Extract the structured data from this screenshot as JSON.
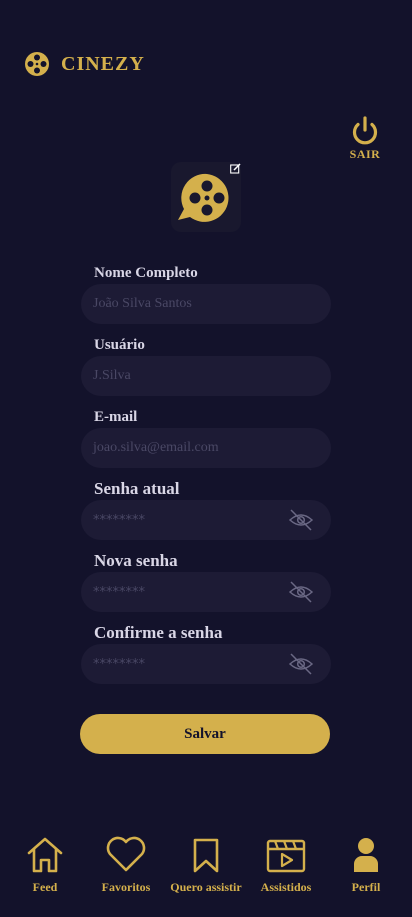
{
  "app": {
    "name": "CINEZY"
  },
  "header": {
    "logout_label": "SAIR"
  },
  "form": {
    "full_name": {
      "label": "Nome Completo",
      "placeholder": "João Silva Santos"
    },
    "username": {
      "label": "Usuário",
      "placeholder": "J.Silva"
    },
    "email": {
      "label": "E-mail",
      "placeholder": "joao.silva@email.com"
    },
    "current_password": {
      "label": "Senha atual",
      "masked": "********"
    },
    "new_password": {
      "label": "Nova senha",
      "masked": "********"
    },
    "confirm_password": {
      "label": "Confirme a senha",
      "masked": "********"
    },
    "save_label": "Salvar"
  },
  "nav": {
    "items": [
      {
        "label": "Feed",
        "icon": "home-icon"
      },
      {
        "label": "Favoritos",
        "icon": "heart-icon"
      },
      {
        "label": "Quero assistir",
        "icon": "bookmark-icon"
      },
      {
        "label": "Assistidos",
        "icon": "clapperboard-icon"
      },
      {
        "label": "Perfil",
        "icon": "user-icon"
      }
    ]
  },
  "colors": {
    "background": "#13122b",
    "accent": "#d4b04c",
    "field": "#1d1b35"
  }
}
